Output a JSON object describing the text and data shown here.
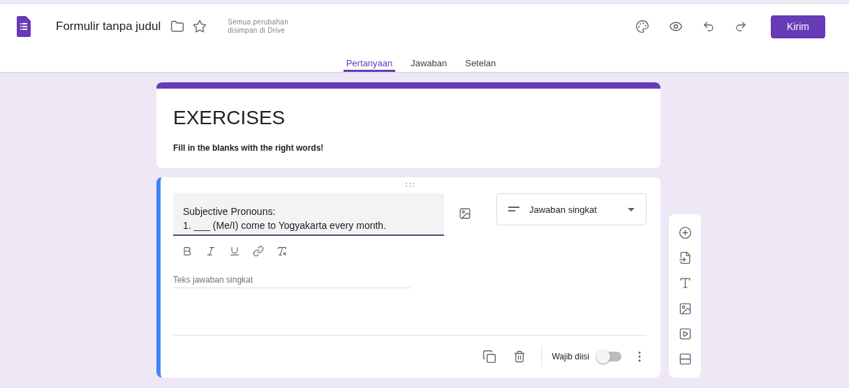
{
  "header": {
    "title": "Formulir tanpa judul",
    "save_status": "Semua perubahan disimpan di Drive",
    "send_button": "Kirim"
  },
  "tabs": [
    {
      "label": "Pertanyaan",
      "selected": true
    },
    {
      "label": "Jawaban",
      "selected": false
    },
    {
      "label": "Setelan",
      "selected": false
    }
  ],
  "form_header": {
    "title": "EXERCISES",
    "description": "Fill in the blanks with the right words!"
  },
  "question": {
    "text_lines": [
      "Subjective Pronouns:",
      "1. ___ (Me/I) come to Yogyakarta every month."
    ],
    "type": "Jawaban singkat",
    "answer_placeholder": "Teks jawaban singkat",
    "required_label": "Wajib diisi",
    "required_on": false
  }
}
